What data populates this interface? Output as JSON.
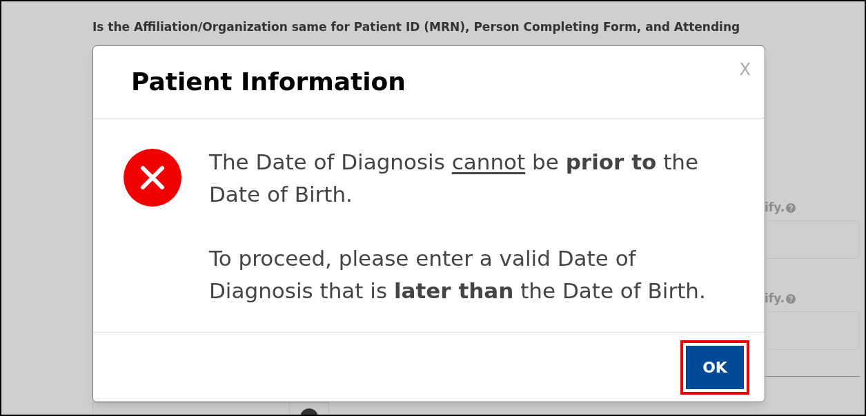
{
  "background_form": {
    "question": "Is the Affiliation/Organization same for Patient ID (MRN), Person Completing Form, and Attending",
    "fields": [
      {
        "label": "ify."
      },
      {
        "label": "ify."
      }
    ]
  },
  "dialog": {
    "title": "Patient Information",
    "close": "X",
    "paragraphs": [
      [
        {
          "kind": "plain",
          "text": "The Date of Diagnosis "
        },
        {
          "kind": "underline",
          "text": "cannot"
        },
        {
          "kind": "plain",
          "text": " be "
        },
        {
          "kind": "bold",
          "text": "prior to"
        },
        {
          "kind": "plain",
          "text": " the Date of Birth."
        }
      ],
      [
        {
          "kind": "plain",
          "text": "To proceed, please enter a valid Date of Diagnosis that is "
        },
        {
          "kind": "bold",
          "text": "later than"
        },
        {
          "kind": "plain",
          "text": " the Date of Birth."
        }
      ]
    ],
    "button": {
      "label": "OK",
      "highlighted": true
    }
  }
}
